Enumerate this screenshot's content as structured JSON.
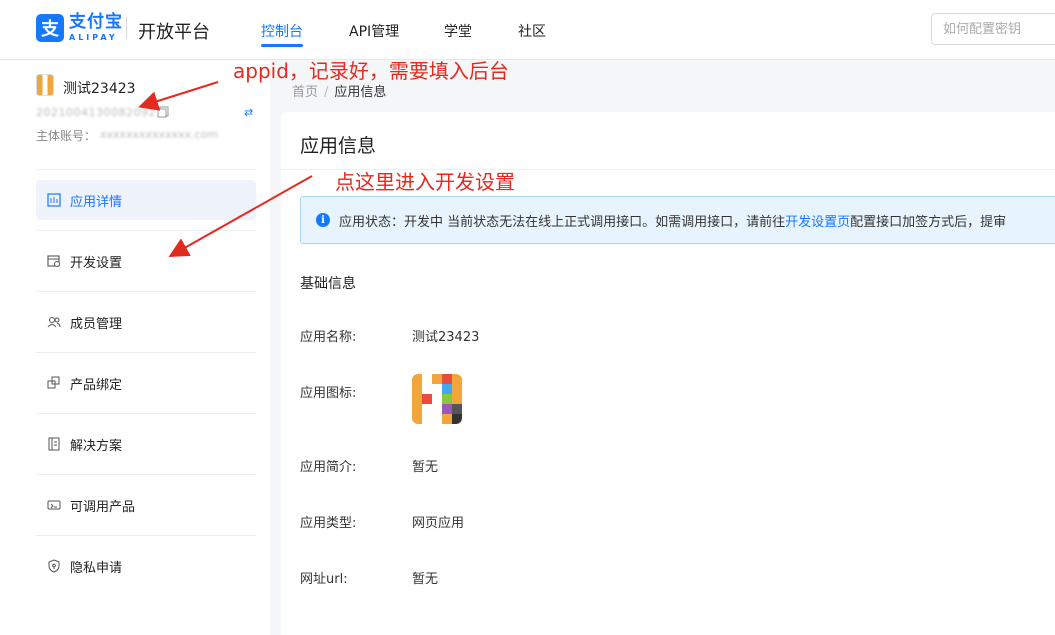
{
  "header": {
    "logo_text": "支",
    "brand_cn": "支付宝",
    "brand_en": "ALIPAY",
    "platform": "开放平台",
    "nav": [
      {
        "label": "控制台",
        "active": true
      },
      {
        "label": "API管理",
        "active": false
      },
      {
        "label": "学堂",
        "active": false
      },
      {
        "label": "社区",
        "active": false
      }
    ],
    "search_placeholder": "如何配置密钥"
  },
  "sidebar": {
    "app_name": "测试23423",
    "appid": "2021004130082092",
    "owner_label": "主体账号：",
    "owner_value": "xxxxxxxxxxxxxx.com",
    "items": [
      {
        "label": "应用详情",
        "icon": "app-detail-icon",
        "active": true
      },
      {
        "label": "开发设置",
        "icon": "dev-settings-icon",
        "active": false
      },
      {
        "label": "成员管理",
        "icon": "members-icon",
        "active": false
      },
      {
        "label": "产品绑定",
        "icon": "product-bind-icon",
        "active": false
      },
      {
        "label": "解决方案",
        "icon": "solution-icon",
        "active": false
      },
      {
        "label": "可调用产品",
        "icon": "callable-products-icon",
        "active": false
      },
      {
        "label": "隐私申请",
        "icon": "privacy-icon",
        "active": false
      }
    ]
  },
  "breadcrumb": {
    "home": "首页",
    "sep": "/",
    "current": "应用信息"
  },
  "main": {
    "title": "应用信息",
    "alert": {
      "prefix": "应用状态：开发中 当前状态无法在线上正式调用接口。如需调用接口，请前往",
      "link": "开发设置页",
      "suffix": "配置接口加签方式后，提审"
    },
    "section_title": "基础信息",
    "fields": [
      {
        "label": "应用名称:",
        "value": "测试23423"
      },
      {
        "label": "应用图标:",
        "value": ""
      },
      {
        "label": "应用简介:",
        "value": "暂无"
      },
      {
        "label": "应用类型:",
        "value": "网页应用"
      },
      {
        "label": "网址url:",
        "value": "暂无"
      }
    ]
  },
  "annotations": {
    "appid_note": "appid，记录好，需要填入后台",
    "dev_note": "点这里进入开发设置"
  },
  "colors": {
    "accent": "#1677ff",
    "annotation": "#e32a1f"
  }
}
